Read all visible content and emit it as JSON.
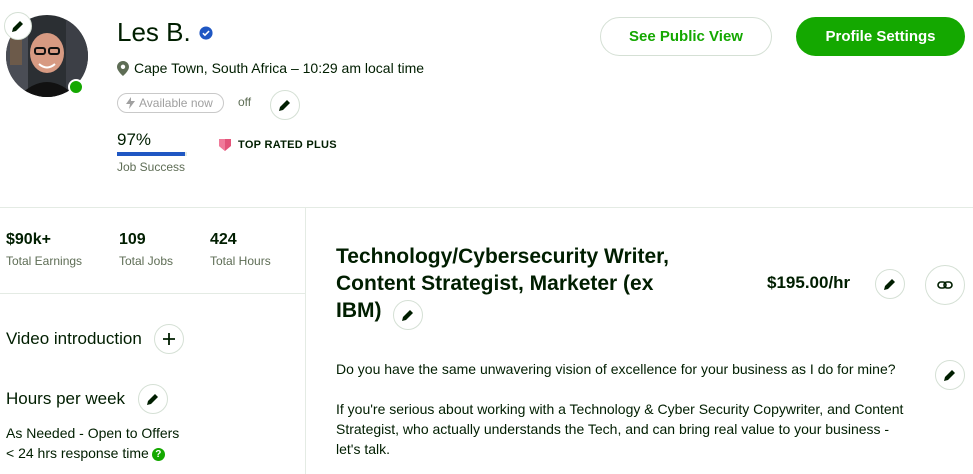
{
  "profile": {
    "name": "Les B.",
    "location": "Cape Town, South Africa – 10:29 am local time",
    "availability_label": "Available now",
    "availability_state": "off",
    "job_success_value": "97%",
    "job_success_fraction": 0.97,
    "job_success_label": "Job Success",
    "badge_label": "TOP RATED PLUS"
  },
  "actions": {
    "public_view": "See Public View",
    "settings": "Profile Settings"
  },
  "stats": [
    {
      "value": "$90k+",
      "label": "Total Earnings"
    },
    {
      "value": "109",
      "label": "Total Jobs"
    },
    {
      "value": "424",
      "label": "Total Hours"
    }
  ],
  "sidebar": {
    "video_intro": "Video introduction",
    "hours_title": "Hours per week",
    "hours_value": "As Needed - Open to Offers",
    "response_time": "< 24 hrs response time",
    "help_glyph": "?"
  },
  "main": {
    "title": "Technology/Cybersecurity Writer, Content Strategist, Marketer (ex IBM)",
    "rate": "$195.00/hr",
    "paragraph1": "Do you have the same unwavering vision of excellence for your business as I do for mine?",
    "paragraph2": "If you're serious about working with a Technology & Cyber Security Copywriter, and Content Strategist, who actually understands the Tech, and can bring real value to your business - let's talk."
  },
  "colors": {
    "brand_green": "#14a800",
    "text": "#001e00",
    "muted": "#5e6d55",
    "progress_blue": "#1f57c3",
    "badge_pink": "#e3547a"
  },
  "icons": [
    "pencil-icon",
    "verified-icon",
    "location-pin-icon",
    "bolt-icon",
    "plus-icon",
    "link-icon",
    "help-icon",
    "top-rated-plus-badge-icon"
  ]
}
